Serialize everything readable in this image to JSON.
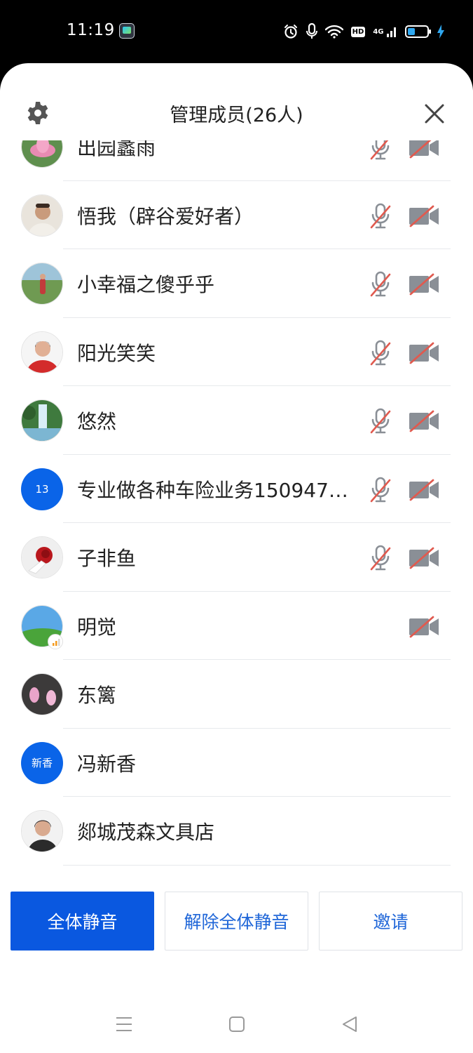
{
  "status_bar": {
    "time": "11:19",
    "hd": "HD",
    "network": "4G",
    "battery_level": 0.4
  },
  "header": {
    "title": "管理成员(26人)"
  },
  "members": [
    {
      "name": "出园蠡雨",
      "avatar_type": "image",
      "avatar_style": "lotus",
      "mic_muted": true,
      "cam_off": true,
      "signal_badge": false
    },
    {
      "name": "悟我（辟谷爱好者）",
      "avatar_type": "image",
      "avatar_style": "man",
      "mic_muted": true,
      "cam_off": true,
      "signal_badge": false
    },
    {
      "name": "小幸福之傻乎乎",
      "avatar_type": "image",
      "avatar_style": "outdoor",
      "mic_muted": true,
      "cam_off": true,
      "signal_badge": false
    },
    {
      "name": "阳光笑笑",
      "avatar_type": "image",
      "avatar_style": "woman-red",
      "mic_muted": true,
      "cam_off": true,
      "signal_badge": false
    },
    {
      "name": "悠然",
      "avatar_type": "image",
      "avatar_style": "waterfall",
      "mic_muted": true,
      "cam_off": true,
      "signal_badge": false
    },
    {
      "name": "专业做各种车险业务150947…",
      "avatar_type": "text",
      "avatar_text": "13",
      "mic_muted": true,
      "cam_off": true,
      "signal_badge": false
    },
    {
      "name": "子非鱼",
      "avatar_type": "image",
      "avatar_style": "rose",
      "mic_muted": true,
      "cam_off": true,
      "signal_badge": false
    },
    {
      "name": "明觉",
      "avatar_type": "image",
      "avatar_style": "field",
      "mic_muted": false,
      "cam_off": true,
      "signal_badge": true
    },
    {
      "name": "东篱",
      "avatar_type": "image",
      "avatar_style": "magnolia",
      "mic_muted": false,
      "cam_off": false,
      "signal_badge": false
    },
    {
      "name": "冯新香",
      "avatar_type": "text",
      "avatar_text": "新香",
      "mic_muted": false,
      "cam_off": false,
      "signal_badge": false
    },
    {
      "name": "郯城茂森文具店",
      "avatar_type": "image",
      "avatar_style": "woman",
      "mic_muted": false,
      "cam_off": false,
      "signal_badge": false
    }
  ],
  "actions": {
    "mute_all": "全体静音",
    "unmute_all": "解除全体静音",
    "invite": "邀请"
  },
  "colors": {
    "primary": "#0a58e0",
    "avatar_blue": "#0a64e8",
    "muted_red": "#e05a4f",
    "icon_gray": "#8a8f96"
  }
}
